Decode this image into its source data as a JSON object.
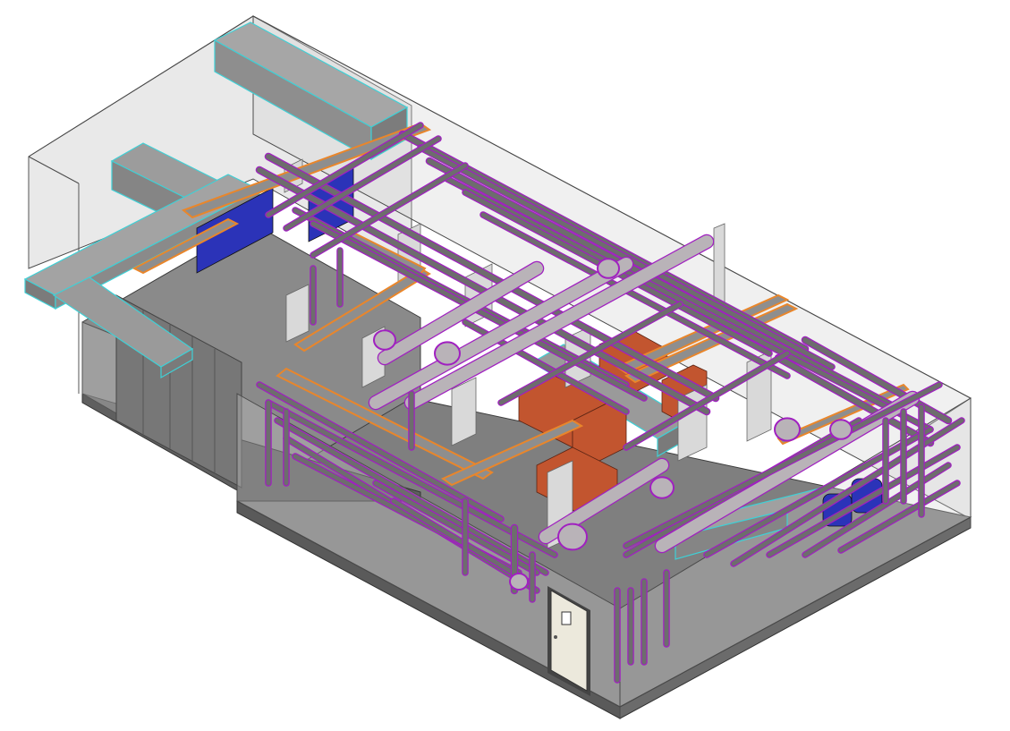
{
  "scene": {
    "subject": "",
    "colors": {
      "background": "#ffffff",
      "enclosure_glass": "#c9c9c9",
      "enclosure_edge": "#4a4a4a",
      "floor": "#7a7a7a",
      "floor_dark": "#5e5e5e",
      "air_duct": "#8f8f8f",
      "air_duct_edge": "#3fd0d6",
      "air_duct_top": "#a7a7a7",
      "pipe_fill": "#b9b3b8",
      "pipe_edge": "#a020c0",
      "pipe_dark": "#6d6d6d",
      "orange_tray": "#e9862b",
      "orange_tray_fill": "#8d8d8d",
      "equipment_red": "#c2552f",
      "equipment_blue": "#2b33b8",
      "column": "#d6d6d6",
      "door": "#ece9dc",
      "door_frame": "#444444"
    },
    "icons": {
      "door": "door-icon"
    }
  }
}
